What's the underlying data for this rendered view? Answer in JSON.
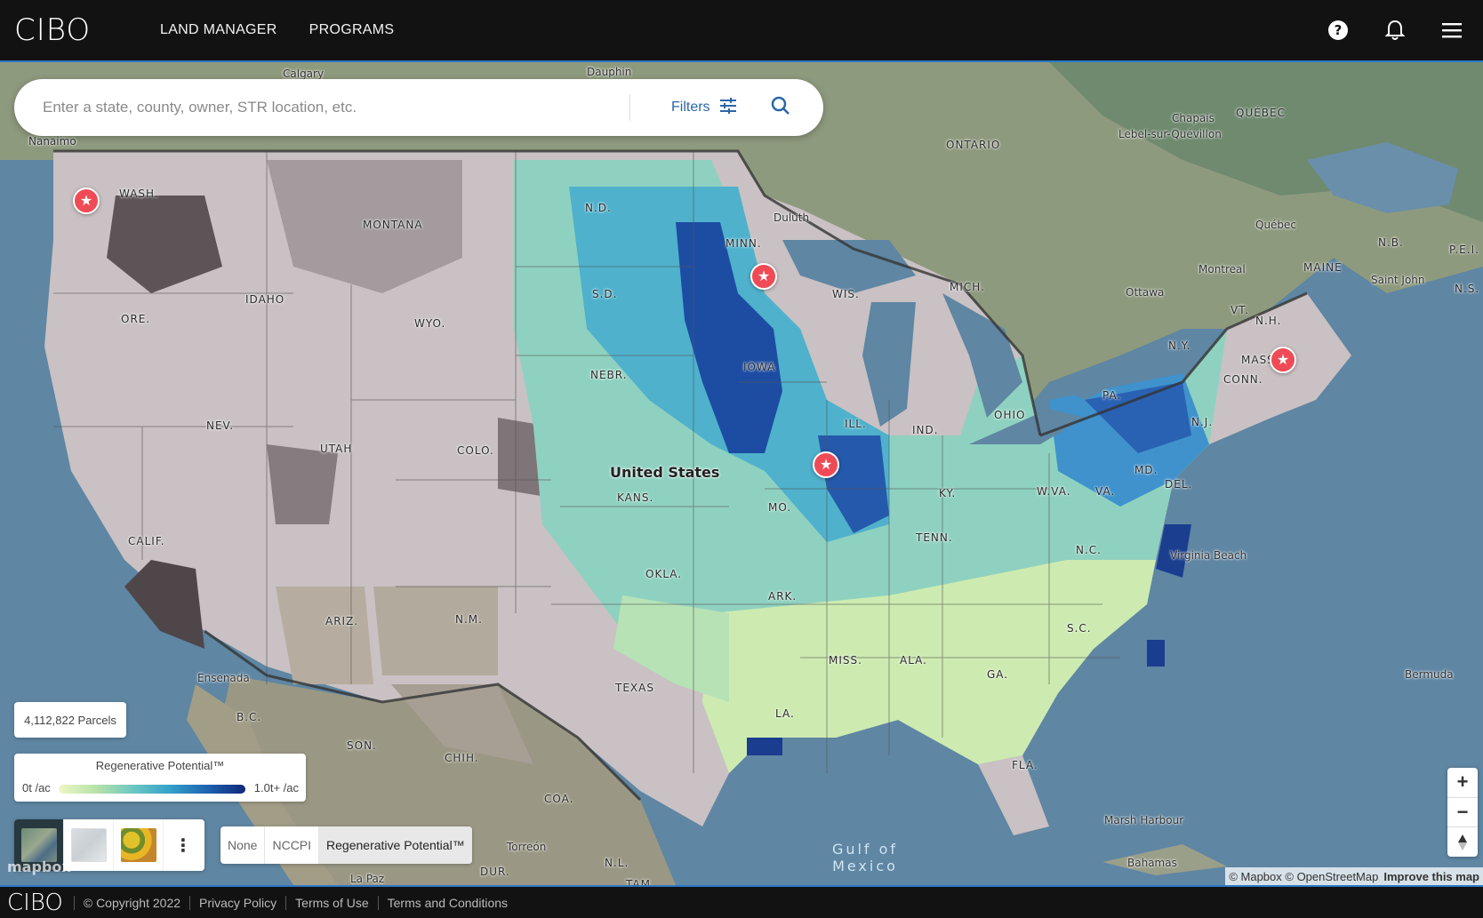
{
  "app": {
    "logo": "CIBO",
    "nav": [
      "LAND MANAGER",
      "PROGRAMS"
    ],
    "icons": [
      "help-icon",
      "bell-icon",
      "menu-icon"
    ]
  },
  "search": {
    "placeholder": "Enter a state, county, owner, STR location, etc.",
    "filters_label": "Filters"
  },
  "map": {
    "labels": {
      "country": "United States",
      "states": [
        "WASH.",
        "MONTANA",
        "N.D.",
        "MINN.",
        "S.D.",
        "WIS.",
        "MICH.",
        "ORE.",
        "IDAHO",
        "WYO.",
        "IOWA",
        "NEBR.",
        "N.Y.",
        "VT.",
        "N.H.",
        "MAINE",
        "MASS.",
        "CONN.",
        "PA.",
        "N.J.",
        "NEV.",
        "UTAH",
        "COLO.",
        "KANS.",
        "ILL.",
        "IND.",
        "OHIO",
        "MD.",
        "DEL.",
        "W.VA.",
        "VA.",
        "CALIF.",
        "MO.",
        "KY.",
        "TENN.",
        "N.C.",
        "OKLA.",
        "ARK.",
        "S.C.",
        "ARIZ.",
        "N.M.",
        "MISS.",
        "ALA.",
        "GA.",
        "TEXAS",
        "LA.",
        "FLA.",
        "B.C.",
        "SON.",
        "CHIH.",
        "COA.",
        "DUR.",
        "N.L.",
        "TAM.",
        "ONTARIO",
        "QUÉBEC",
        "N.B.",
        "P.E.I.",
        "N.S."
      ],
      "cities": [
        "Calgary",
        "Dauphin",
        "Nanaimo",
        "Duluth",
        "Chapais",
        "Lebel-sur-Quévillon",
        "Québec",
        "Montreal",
        "Ottawa",
        "Saint John",
        "Virginia Beach",
        "Ensenada",
        "Torreón",
        "La Paz",
        "Marsh Harbour",
        "Bahamas",
        "Bermuda"
      ],
      "water": "Gulf of Mexico"
    },
    "marker_icon": "star-icon",
    "marker_count": 5
  },
  "parcels": {
    "label": "4,112,822 Parcels"
  },
  "legend": {
    "title": "Regenerative Potential™",
    "min_label": "0t /ac",
    "max_label": "1.0t+ /ac",
    "gradient": [
      "#eef7c5",
      "#b8e2a8",
      "#6cc7c3",
      "#33a0c9",
      "#1e62b0",
      "#10277a"
    ]
  },
  "basemaps": [
    "satellite",
    "streets",
    "soil"
  ],
  "layers": {
    "options": [
      "None",
      "NCCPI",
      "Regenerative Potential™"
    ],
    "selected": "Regenerative Potential™"
  },
  "attribution": {
    "text": "© Mapbox © OpenStreetMap",
    "improve": "Improve this map",
    "logo": "mapbox"
  },
  "footer": {
    "logo": "CIBO",
    "copyright": "© Copyright 2022",
    "links": [
      "Privacy Policy",
      "Terms of Use",
      "Terms and Conditions"
    ]
  }
}
